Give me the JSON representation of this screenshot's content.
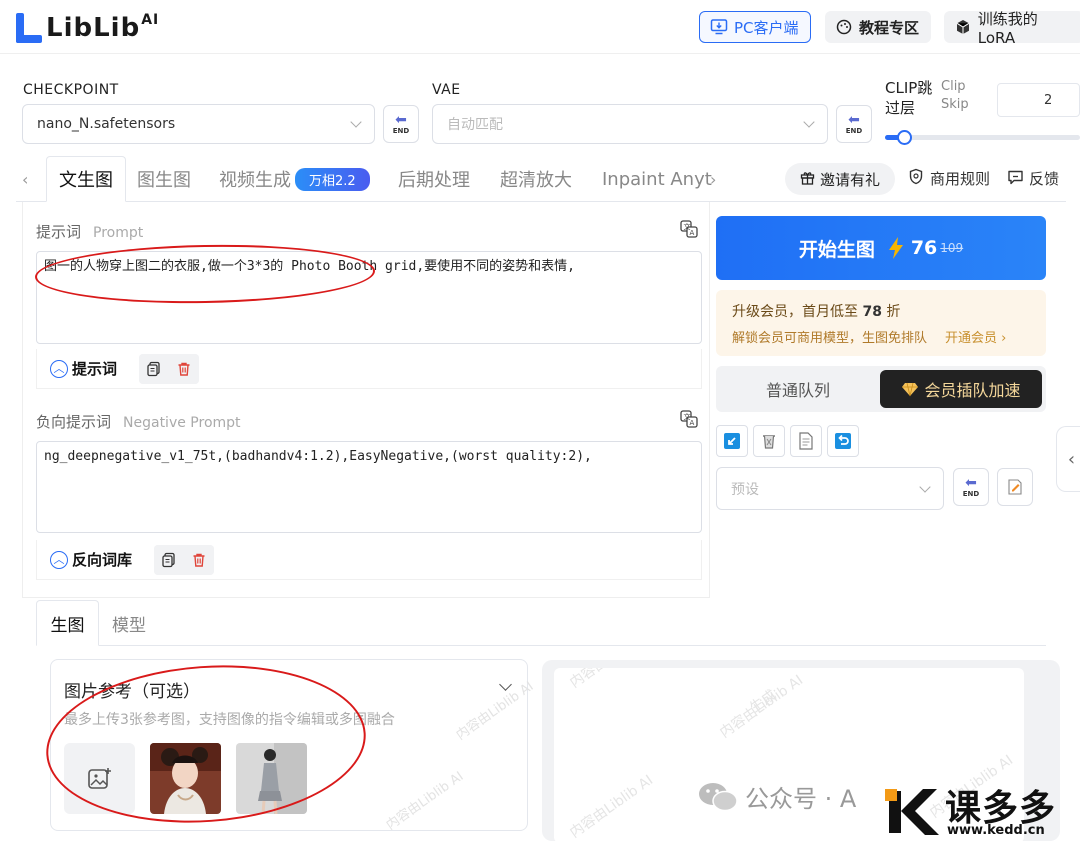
{
  "header": {
    "logo_text": "LibLib",
    "logo_sup": "AI",
    "pc_client": "PC客户端",
    "tutorial": "教程专区",
    "train_lora": "训练我的LoRA"
  },
  "checkpoint": {
    "label": "CHECKPOINT",
    "value": "nano_N.safetensors"
  },
  "vae": {
    "label": "VAE",
    "placeholder": "自动匹配"
  },
  "clip": {
    "label": "CLIP跳过层",
    "sublabel": "Clip Skip",
    "value": "2"
  },
  "end_label": "END",
  "tabs": [
    {
      "label": "文生图",
      "active": true
    },
    {
      "label": "图生图"
    },
    {
      "label": "视频生成",
      "badge": "万相2.2"
    },
    {
      "label": "后期处理"
    },
    {
      "label": "超清放大"
    },
    {
      "label": "Inpaint Anyt"
    }
  ],
  "links": {
    "invite": "邀请有礼",
    "rules": "商用规则",
    "feedback": "反馈"
  },
  "prompt": {
    "title": "提示词",
    "title_en": "Prompt",
    "text": "图一的人物穿上图二的衣服,做一个3*3的 Photo Booth grid,要使用不同的姿势和表情,",
    "toggle": "提示词"
  },
  "negative": {
    "title": "负向提示词",
    "title_en": "Negative Prompt",
    "text": "ng_deepnegative_v1_75t,(badhandv4:1.2),EasyNegative,(worst quality:2),",
    "toggle": "反向词库"
  },
  "generate": {
    "label": "开始生图",
    "count": "76",
    "old_count": "109"
  },
  "vip": {
    "line1_prefix": "升级会员，首月低至 ",
    "line1_value": "78",
    "line1_suffix": " 折",
    "line2": "解锁会员可商用模型，生图免排队",
    "open": "开通会员 ›"
  },
  "queue": {
    "normal": "普通队列",
    "vip": "会员插队加速"
  },
  "preset": {
    "placeholder": "预设"
  },
  "bottom_tabs": [
    {
      "label": "生图",
      "active": true
    },
    {
      "label": "模型"
    }
  ],
  "ref": {
    "title": "图片参考（可选）",
    "hint": "最多上传3张参考图，支持图像的指令编辑或多图融合"
  },
  "watermarks": {
    "repeat": "内容由Liblib AI 生成",
    "wechat": "公众号 · A",
    "brand": "课多多",
    "url": "www.kedd.cn"
  },
  "colors": {
    "accent": "#2a6cf5",
    "annotation": "#d91a1a",
    "vip_gold": "#f4d79a"
  }
}
